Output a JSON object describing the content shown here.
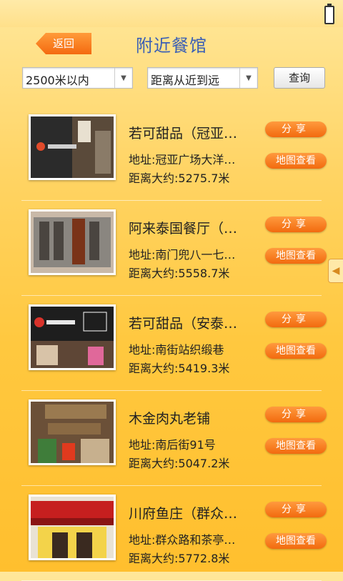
{
  "header": {
    "back_label": "返回",
    "title": "附近餐馆"
  },
  "filters": {
    "range": "2500米以内",
    "sort": "距离从近到远",
    "query_label": "查询"
  },
  "buttons": {
    "share": "分享",
    "map": "地图查看"
  },
  "restaurants": [
    {
      "name": "若可甜品（冠亚…",
      "address": "地址:冠亚广场大洋…",
      "distance": "距离大约:5275.7米"
    },
    {
      "name": "阿来泰国餐厅（…",
      "address": "地址:南门兜八一七…",
      "distance": "距离大约:5558.7米"
    },
    {
      "name": "若可甜品（安泰…",
      "address": "地址:南街站织缎巷",
      "distance": "距离大约:5419.3米"
    },
    {
      "name": "木金肉丸老铺",
      "address": "地址:南后街91号",
      "distance": "距离大约:5047.2米"
    },
    {
      "name": "川府鱼庄（群众…",
      "address": "地址:群众路和茶亭…",
      "distance": "距离大约:5772.8米"
    }
  ]
}
